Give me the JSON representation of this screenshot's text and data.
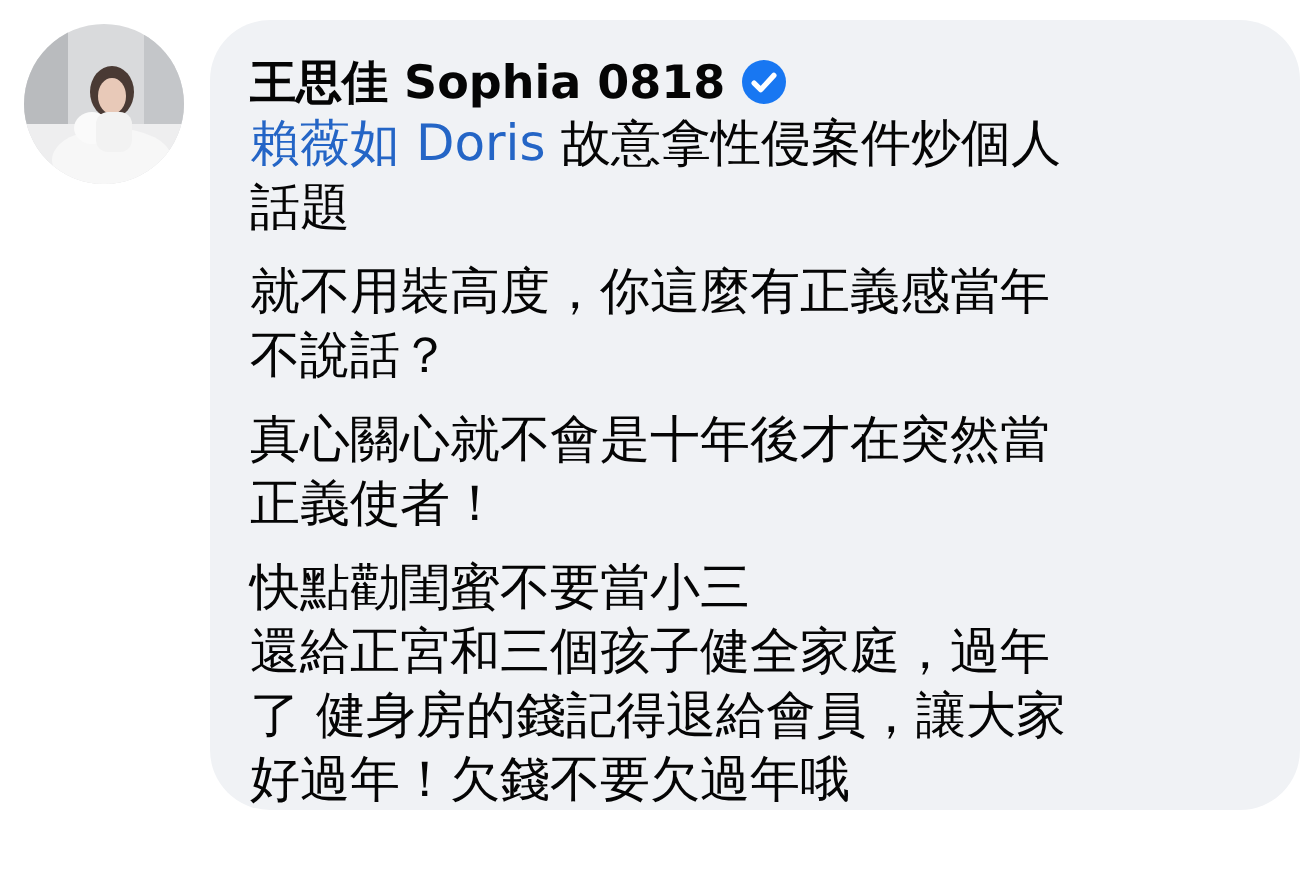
{
  "comment": {
    "author": "王思佳 Sophia 0818",
    "verified": true,
    "paragraphs": [
      {
        "mention": "賴薇如 Doris",
        "lines": [
          " 故意拿性侵案件炒個人",
          "話題"
        ]
      },
      {
        "lines": [
          "就不用裝高度，你這麼有正義感當年",
          "不說話？"
        ]
      },
      {
        "lines": [
          "真心關心就不會是十年後才在突然當",
          "正義使者！"
        ]
      },
      {
        "lines": [
          "快點勸閨蜜不要當小三",
          "還給正宮和三個孩子健全家庭，過年",
          "了 健身房的錢記得退給會員，讓大家",
          "好過年！欠錢不要欠過年哦"
        ]
      }
    ]
  }
}
